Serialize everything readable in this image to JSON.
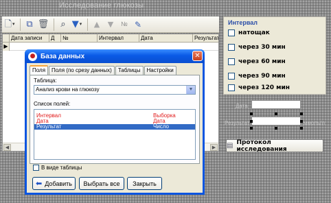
{
  "form": {
    "title": "Исследование глюкозы"
  },
  "toolbar": {
    "icons": [
      "new-doc-icon",
      "copy-icon",
      "trash-icon",
      "binoculars-icon",
      "filter-icon",
      "arrow-up-icon",
      "arrow-down-icon",
      "numbering-icon",
      "edit-icon"
    ],
    "numbering_glyph": "№"
  },
  "grid": {
    "columns": [
      "Дата записи",
      "Д",
      "№",
      "Интервал",
      "Дата",
      "Результат"
    ],
    "current_row_marker": "▶"
  },
  "interval_panel": {
    "title": "Интервал",
    "options": [
      {
        "label": "натощак",
        "checked": false
      },
      {
        "label": "через 30 мин",
        "checked": false
      },
      {
        "label": "через 60 мин",
        "checked": false
      },
      {
        "label": "через 90 мин",
        "checked": false
      },
      {
        "label": "через 120 мин",
        "checked": false
      }
    ]
  },
  "ghost_labels": {
    "date_label": "Дата",
    "result_label": "Результат",
    "result_suffix": "ммоль/л"
  },
  "report_button": {
    "label": "Протокол исследования"
  },
  "dialog": {
    "title": "База данных",
    "close_glyph": "✕",
    "tabs": [
      "Поля",
      "Поля (по срезу данных)",
      "Таблицы",
      "Настройки"
    ],
    "active_tab": 0,
    "table_label": "Таблица:",
    "table_value": "Анализ крови на глюкозу",
    "fields_label": "Список полей:",
    "fields": [
      {
        "name": "Интервал",
        "type": "Выборка",
        "style": "red"
      },
      {
        "name": "Дата",
        "type": "Дата",
        "style": "red"
      },
      {
        "name": "Результат",
        "type": "Число",
        "style": "selected"
      }
    ],
    "as_table_label": "В виде таблицы",
    "as_table_checked": false,
    "buttons": {
      "add": "Добавить",
      "select_all": "Выбрать все",
      "close": "Закрыть"
    }
  },
  "colors": {
    "dialog_title_blue": "#0a55e0",
    "selection_blue": "#316ac5",
    "required_red": "#e11b1b",
    "panel_title_blue": "#2b4ea8"
  }
}
